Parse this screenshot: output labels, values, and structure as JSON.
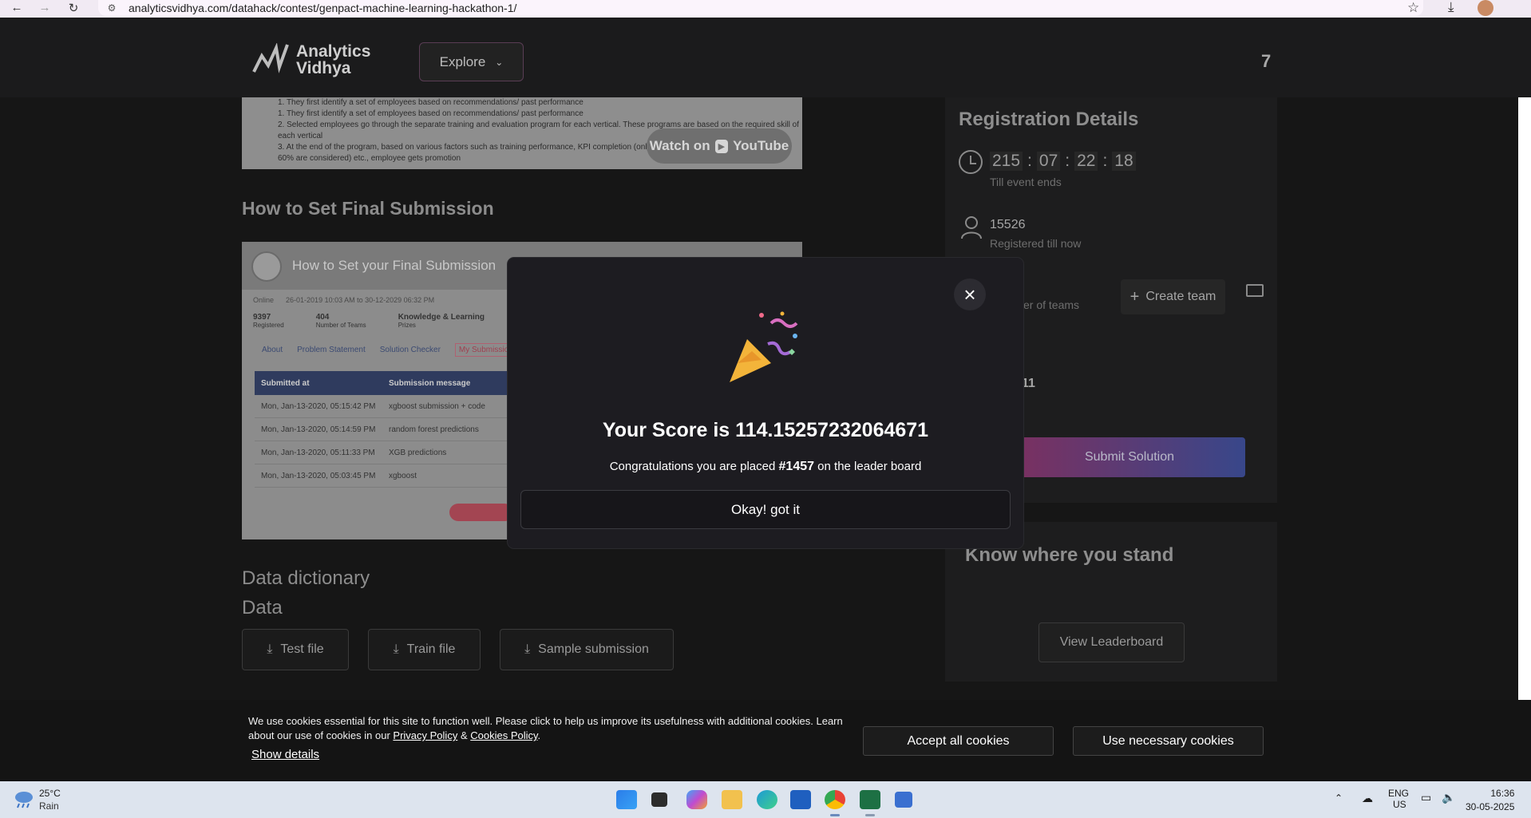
{
  "browser": {
    "url": "analyticsvidhya.com/datahack/contest/genpact-machine-learning-hackathon-1/",
    "back_icon": "arrow-left-icon",
    "forward_icon": "arrow-right-icon",
    "reload_icon": "reload-icon"
  },
  "header": {
    "logo_line1": "Analytics",
    "logo_line2": "Vidhya",
    "explore_label": "Explore",
    "notification_count": "7"
  },
  "video_top": {
    "lines": [
      "1. They first identify a set of employees based on recommendations/ past performance",
      "2. Selected employees go through the separate training and evaluation program for each vertical. These programs are based on the required skill of",
      "   each vertical",
      "3. At the end of the program, based on various factors such as training performance, KPI completion (only empl",
      "   60% are considered) etc., employee gets promotion"
    ],
    "watch_on": "Watch on",
    "youtube": "YouTube"
  },
  "section_submission": "How to Set Final Submission",
  "video2": {
    "title": "How to Set your Final Submission",
    "meta_online": "Online",
    "meta_dates": "26-01-2019 10:03 AM to 30-12-2029 06:32 PM",
    "stats": [
      {
        "value": "9397",
        "label": "Registered"
      },
      {
        "value": "404",
        "label": "Number of Teams"
      },
      {
        "value": "Knowledge & Learning",
        "label": "Prizes"
      }
    ],
    "tabs": [
      "About",
      "Problem Statement",
      "Solution Checker",
      "My Submissions"
    ],
    "columns": [
      "Submitted at",
      "Submission message"
    ],
    "rows": [
      [
        "Mon, Jan-13-2020, 05:15:42 PM",
        "xgboost submission + code"
      ],
      [
        "Mon, Jan-13-2020, 05:14:59 PM",
        "random forest predictions"
      ],
      [
        "Mon, Jan-13-2020, 05:11:33 PM",
        "XGB predictions"
      ],
      [
        "Mon, Jan-13-2020, 05:03:45 PM",
        "xgboost"
      ]
    ]
  },
  "data_dictionary_label": "Data dictionary",
  "data_label": "Data",
  "downloads": [
    "Test file",
    "Train file",
    "Sample submission"
  ],
  "registration": {
    "title": "Registration Details",
    "timer": [
      "215",
      "07",
      "22",
      "18"
    ],
    "timer_note": "Till event ends",
    "registered_count": "15526",
    "registered_note": "Registered till now",
    "teams_note": "er of teams",
    "create_team": "Create team",
    "partial_value": "11",
    "submit_label": "Submit Solution"
  },
  "know": {
    "title": "Know where you stand",
    "leaderboard_label": "View Leaderboard"
  },
  "modal": {
    "score_title": "Your Score is 114.15257232064671",
    "congrats_prefix": "Congratulations you are placed ",
    "rank": "#1457",
    "congrats_suffix": " on the leader board",
    "ok_label": "Okay! got it"
  },
  "cookies": {
    "text": "We use cookies essential for this site to function well. Please click to help us improve its usefulness with additional cookies. Learn about our use of cookies in our",
    "privacy": "Privacy Policy",
    "and": "&",
    "cookies_policy": "Cookies Policy",
    "period": ".",
    "show_details": "Show details",
    "accept_all": "Accept all cookies",
    "necessary": "Use necessary cookies"
  },
  "taskbar": {
    "temp": "25°C",
    "weather": "Rain",
    "lang1": "ENG",
    "lang2": "US",
    "time": "16:36",
    "date": "30-05-2025"
  }
}
